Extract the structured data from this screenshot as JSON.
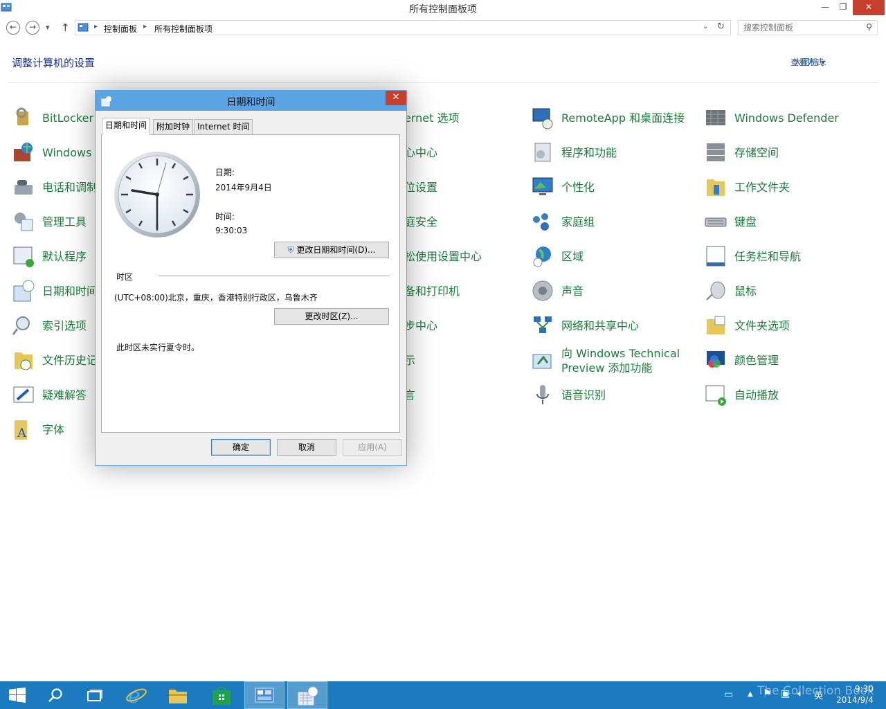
{
  "window": {
    "title": "所有控制面板项",
    "controls": {
      "minimize": "—",
      "restore": "❐",
      "close": "✕"
    }
  },
  "nav": {
    "back": "←",
    "forward": "→",
    "dropdown": "▾",
    "up": "↑",
    "breadcrumb": [
      "控制面板",
      "所有控制面板项"
    ],
    "search_placeholder": "搜索控制面板"
  },
  "header": {
    "title": "调整计算机的设置",
    "view_by_label": "查看方式:",
    "view_by_value": "大图标 ▾"
  },
  "items": {
    "col1": [
      "BitLocker",
      "Windows",
      "电话和调制",
      "管理工具",
      "默认程序",
      "日期和时间",
      "索引选项",
      "文件历史记",
      "疑难解答",
      "字体"
    ],
    "col2": [
      "ernet 选项",
      "心中心",
      "位设置",
      "庭安全",
      "松使用设置中心",
      "备和打印机",
      "步中心",
      "示",
      "言"
    ],
    "col3": [
      "RemoteApp 和桌面连接",
      "程序和功能",
      "个性化",
      "家庭组",
      "区域",
      "声音",
      "网络和共享中心",
      "向 Windows Technical Preview 添加功能",
      "语音识别"
    ],
    "col4": [
      "Windows Defender",
      "存储空间",
      "工作文件夹",
      "键盘",
      "任务栏和导航",
      "鼠标",
      "文件夹选项",
      "颜色管理",
      "自动播放"
    ]
  },
  "dialog": {
    "title": "日期和时间",
    "close": "✕",
    "tabs": [
      "日期和时间",
      "附加时钟",
      "Internet 时间"
    ],
    "date_label": "日期:",
    "date_value": "2014年9月4日",
    "time_label": "时间:",
    "time_value": "9:30:03",
    "change_datetime_button": "更改日期和时间(D)...",
    "timezone_label": "时区",
    "timezone_value": "(UTC+08:00)北京，重庆，香港特别行政区，乌鲁木齐",
    "change_timezone_button": "更改时区(Z)...",
    "dst_note": "此时区未实行夏令时。",
    "ok": "确定",
    "cancel": "取消",
    "apply": "应用(A)"
  },
  "taskbar": {
    "ime": "英",
    "clock_time": "9:30",
    "clock_date": "2014/9/4",
    "watermark": "The Collection Book"
  },
  "colors": {
    "accent": "#5ba4e4",
    "link_green": "#1c7b3b",
    "heading_blue": "#1e3287",
    "taskbar": "#1c7bbf",
    "close_red": "#c7402d"
  }
}
